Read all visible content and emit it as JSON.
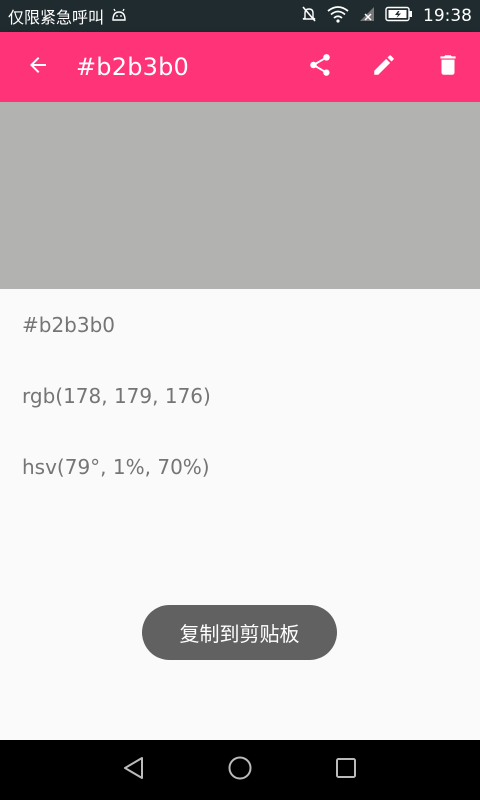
{
  "status_bar": {
    "carrier_text": "仅限紧急呼叫",
    "time": "19:38",
    "icons": [
      "android-icon",
      "mute-icon",
      "wifi-icon",
      "signal-icon",
      "battery-icon"
    ]
  },
  "app_bar": {
    "title": "#b2b3b0",
    "background_color": "#ff3377",
    "icons": [
      "back-arrow-icon",
      "share-icon",
      "edit-icon",
      "delete-icon"
    ]
  },
  "color_preview": {
    "hex": "#b2b3b0"
  },
  "details": {
    "hex": "#b2b3b0",
    "rgb": "rgb(178, 179, 176)",
    "hsv": "hsv(79°, 1%, 70%)"
  },
  "toast": {
    "message": "复制到剪贴板"
  },
  "nav_bar": {
    "icons": [
      "back-nav-icon",
      "home-nav-icon",
      "recents-nav-icon"
    ]
  }
}
